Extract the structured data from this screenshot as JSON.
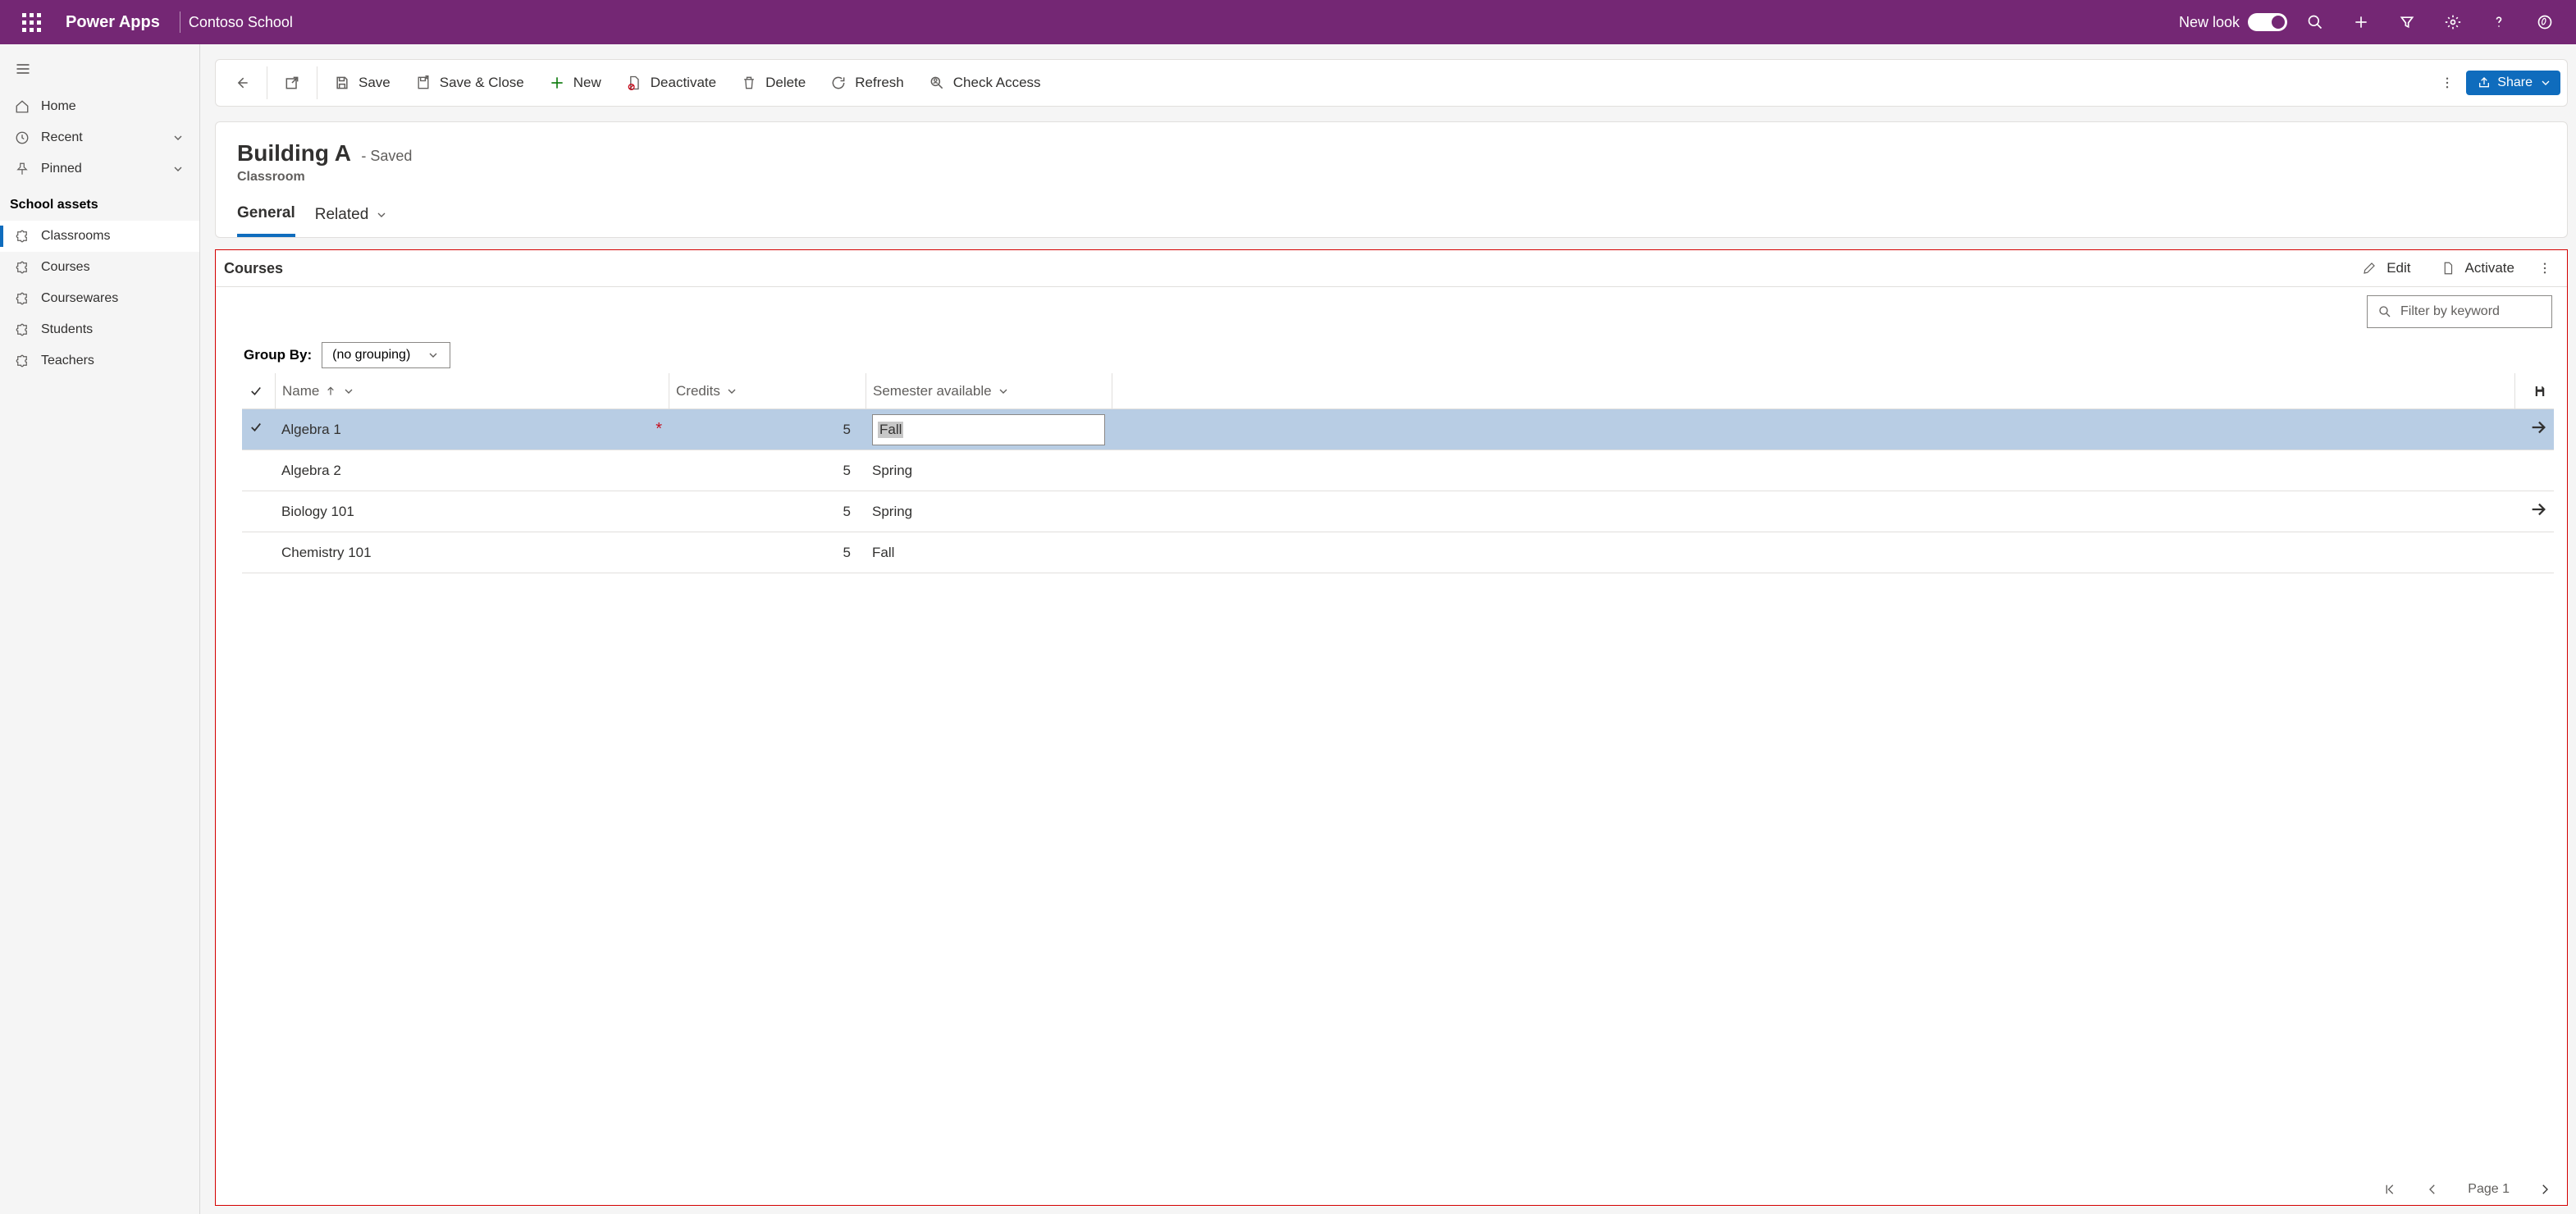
{
  "topbar": {
    "brand": "Power Apps",
    "app_name": "Contoso School",
    "new_look_label": "New look"
  },
  "nav": {
    "home": "Home",
    "recent": "Recent",
    "pinned": "Pinned",
    "group_label": "School assets",
    "items": [
      "Classrooms",
      "Courses",
      "Coursewares",
      "Students",
      "Teachers"
    ]
  },
  "commands": {
    "save": "Save",
    "save_close": "Save & Close",
    "new": "New",
    "deactivate": "Deactivate",
    "delete": "Delete",
    "refresh": "Refresh",
    "check_access": "Check Access",
    "share": "Share"
  },
  "record": {
    "title": "Building A",
    "status": "- Saved",
    "entity": "Classroom",
    "tabs": {
      "general": "General",
      "related": "Related"
    }
  },
  "subgrid": {
    "title": "Courses",
    "header_buttons": {
      "edit": "Edit",
      "activate": "Activate"
    },
    "filter_placeholder": "Filter by keyword",
    "group_by_label": "Group By:",
    "group_by_value": "(no grouping)",
    "columns": {
      "name": "Name",
      "credits": "Credits",
      "semester": "Semester available"
    },
    "rows": [
      {
        "name": "Algebra 1",
        "credits": "5",
        "semester": "Fall",
        "selected": true,
        "editing": true,
        "required": true,
        "arrow": true
      },
      {
        "name": "Algebra 2",
        "credits": "5",
        "semester": "Spring"
      },
      {
        "name": "Biology 101",
        "credits": "5",
        "semester": "Spring",
        "arrow": true
      },
      {
        "name": "Chemistry 101",
        "credits": "5",
        "semester": "Fall"
      }
    ],
    "pager": {
      "page_label": "Page 1"
    }
  }
}
